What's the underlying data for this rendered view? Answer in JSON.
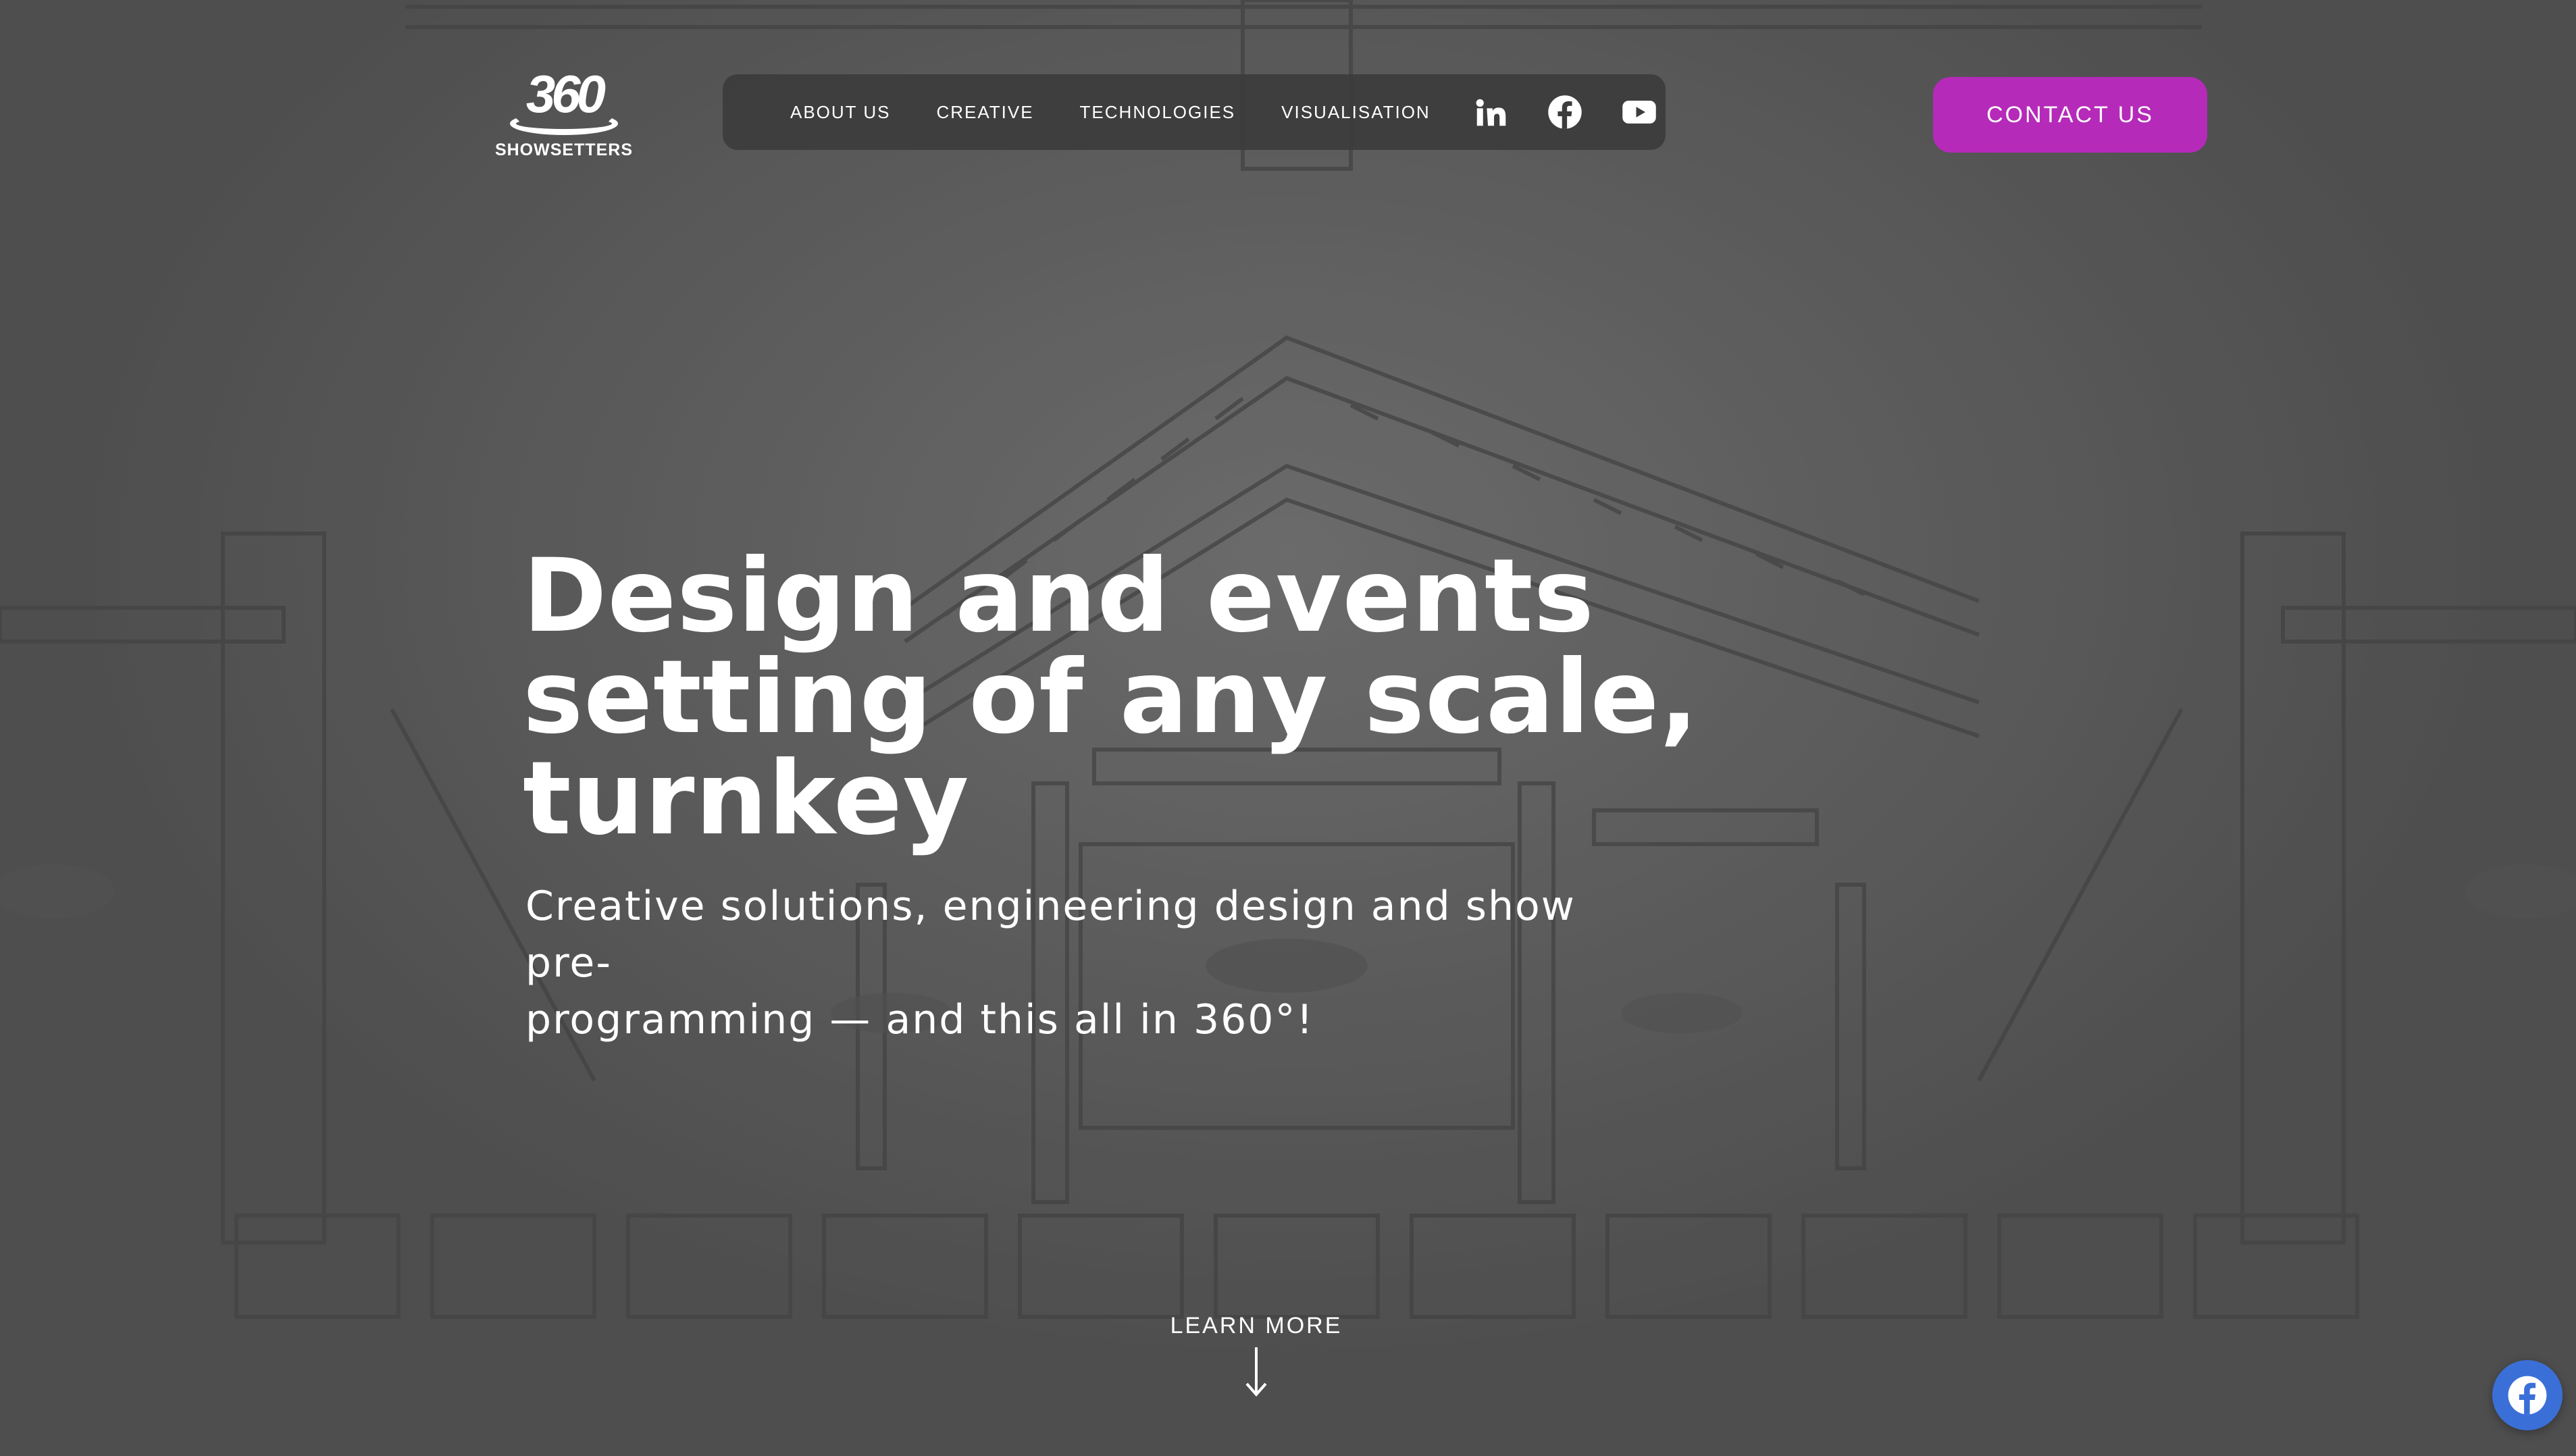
{
  "brand": {
    "logo_number": "360",
    "logo_word": "SHOWSETTERS"
  },
  "nav": {
    "items": [
      {
        "label": "ABOUT US"
      },
      {
        "label": "CREATIVE"
      },
      {
        "label": "TECHNOLOGIES"
      },
      {
        "label": "VISUALISATION"
      }
    ],
    "social_icons": [
      "linkedin-icon",
      "facebook-icon",
      "youtube-icon"
    ]
  },
  "contact_button": {
    "label": "CONTACT US"
  },
  "hero": {
    "headline_lines": [
      "Design and events",
      "setting of any scale,",
      "turnkey"
    ],
    "subtitle_lines": [
      "Creative solutions, engineering design and show pre-",
      "programming — and this all in 360°!"
    ],
    "learn_more": "LEARN MORE"
  },
  "floating": {
    "icon": "facebook-icon"
  },
  "colors": {
    "accent": "#b52ab9",
    "navbar_bg": "#3c3c3c",
    "floating_fb": "#3b6fd8"
  }
}
